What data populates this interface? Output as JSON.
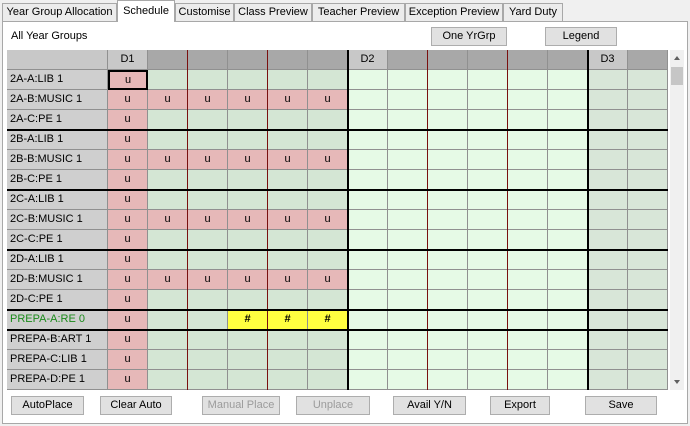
{
  "tabs": [
    {
      "label": "Year Group Allocation",
      "active": false
    },
    {
      "label": "Schedule",
      "active": true
    },
    {
      "label": "Customise",
      "active": false
    },
    {
      "label": "Class Preview",
      "active": false
    },
    {
      "label": "Teacher Preview",
      "active": false
    },
    {
      "label": "Exception Preview",
      "active": false
    },
    {
      "label": "Yard Duty",
      "active": false
    }
  ],
  "header_label": "All Year Groups",
  "top_buttons": {
    "one_yrgrp": "One YrGrp",
    "legend": "Legend"
  },
  "days": [
    "D1",
    "D2",
    "D3"
  ],
  "rows": [
    {
      "label": "2A-A:LIB 1",
      "pattern": "first"
    },
    {
      "label": "2A-B:MUSIC 1",
      "pattern": "music"
    },
    {
      "label": "2A-C:PE 1",
      "pattern": "first"
    },
    {
      "label": "2B-A:LIB 1",
      "pattern": "first"
    },
    {
      "label": "2B-B:MUSIC 1",
      "pattern": "music"
    },
    {
      "label": "2B-C:PE 1",
      "pattern": "first"
    },
    {
      "label": "2C-A:LIB 1",
      "pattern": "first"
    },
    {
      "label": "2C-B:MUSIC 1",
      "pattern": "music"
    },
    {
      "label": "2C-C:PE 1",
      "pattern": "first"
    },
    {
      "label": "2D-A:LIB 1",
      "pattern": "first"
    },
    {
      "label": "2D-B:MUSIC 1",
      "pattern": "music"
    },
    {
      "label": "2D-C:PE 1",
      "pattern": "first"
    },
    {
      "label": "PREPA-A:RE 0",
      "pattern": "re",
      "highlight": true
    },
    {
      "label": "PREPA-B:ART 1",
      "pattern": "first"
    },
    {
      "label": "PREPA-C:LIB 1",
      "pattern": "first"
    },
    {
      "label": "PREPA-D:PE 1",
      "pattern": "first"
    }
  ],
  "marks": {
    "u": "u",
    "hash": "#"
  },
  "bottom_buttons": [
    {
      "label": "AutoPlace",
      "disabled": false
    },
    {
      "label": "Clear Auto",
      "disabled": false
    },
    {
      "label": "Manual Place",
      "disabled": true
    },
    {
      "label": "Unplace",
      "disabled": true
    },
    {
      "label": "Avail Y/N",
      "disabled": false
    },
    {
      "label": "Export",
      "disabled": false
    },
    {
      "label": "Save",
      "disabled": false
    }
  ],
  "colors": {
    "pink": "#e6b8b8",
    "d1_green": "#d4e6d4",
    "d2_green": "#e6fae6",
    "d3_green": "#d8e6d8",
    "yellow": "#ffff40",
    "green_text": "#1a8a1a"
  },
  "icons": {
    "scroll_up": "scroll-up-icon",
    "scroll_down": "scroll-down-icon"
  }
}
